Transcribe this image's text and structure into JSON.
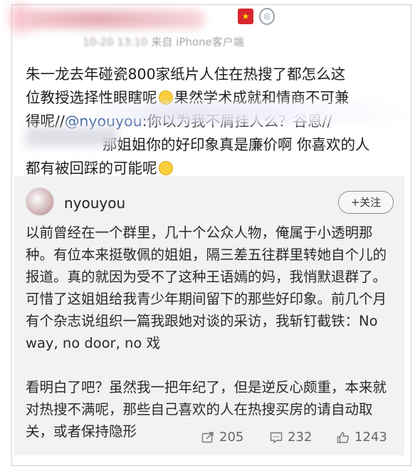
{
  "header": {
    "meta_time": "10-20 13:10",
    "meta_source": "来自 iPhone客户端"
  },
  "post": {
    "line1": "朱一龙去年碰瓷800家纸片人住在热搜了都怎么这",
    "line2a": "位教授选择性眼瞎呢",
    "line2b": "果然学术成就和情商不可兼",
    "line3a": "得呢//",
    "line3_mention": "@nyouyou",
    "line3b": ":你以为我不屑挂人么？谷恩//",
    "line4": "那姐姐你的好印象真是廉价啊 你喜欢的人",
    "line5": "都有被回踩的可能呢"
  },
  "card": {
    "username": "nyouyou",
    "follow_label": "+关注",
    "paragraph1": "以前曾经在一个群里，几十个公众人物，俺属于小透明那种。有位本来挺敬佩的姐姐，隔三差五往群里转她自个儿的报道。真的就因为受不了这种王语嫣的妈，我悄默退群了。可惜了这姐姐给我青少年期间留下的那些好印象。前几个月有个杂志说组织一篇我跟她对谈的采访，我斩钉截铁：No way, no door, no 戏",
    "paragraph2": "看明白了吧？虽然我一把年纪了，但是逆反心颇重，本来就对热搜不满呢，那些自己喜欢的人在热搜买房的请自动取关，或者保持隐形",
    "repost_count": "205",
    "comment_count": "232",
    "like_count": "1243"
  },
  "colors": {
    "mention": "#355f9a",
    "card_background": "#f2f2f2",
    "meta_text": "#a3a3a3"
  },
  "icons": [
    "flag-icon",
    "medal-icon",
    "emoji-icon",
    "repost-icon",
    "comment-icon",
    "like-icon"
  ]
}
